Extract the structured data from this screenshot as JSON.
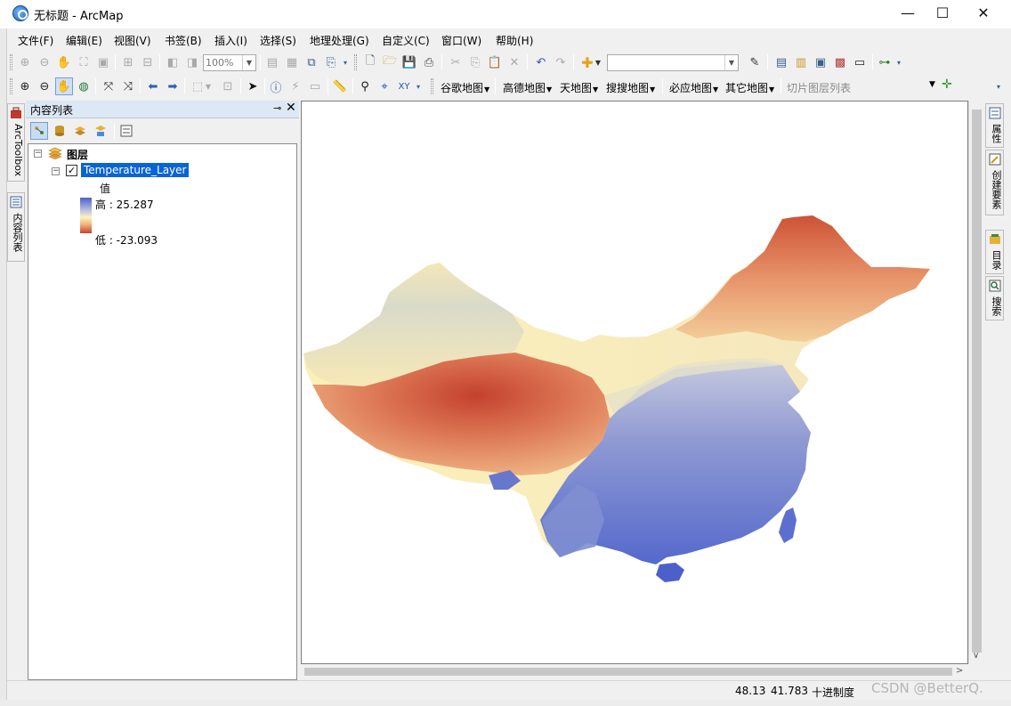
{
  "window": {
    "title": "无标题 - ArcMap",
    "minimize": "—",
    "maximize": "☐",
    "close": "✕"
  },
  "menubar": [
    "文件(F)",
    "编辑(E)",
    "视图(V)",
    "书签(B)",
    "插入(I)",
    "选择(S)",
    "地理处理(G)",
    "自定义(C)",
    "窗口(W)",
    "帮助(H)"
  ],
  "toolbar1": {
    "zoom_value": "100%",
    "scale_combo_value": ""
  },
  "toolbar2": {
    "map_sources": [
      "谷歌地图",
      "高德地图",
      "天地图",
      "搜搜地图",
      "必应地图",
      "其它地图"
    ],
    "tile_list_placeholder": "切片图层列表"
  },
  "left_tabs": {
    "arctoolbox": "ArcToolbox",
    "toc_tab": "内容列表"
  },
  "toc": {
    "title": "内容列表",
    "pin": "ᵖ",
    "close": "✕",
    "root_label": "图层",
    "layer_name": "Temperature_Layer",
    "layer_checked": true,
    "value_label": "值",
    "high_label": "高 : 25.287",
    "low_label": "低 : -23.093",
    "ramp_colors": [
      "#4d60c9",
      "#fbf4bd",
      "#c8402f"
    ]
  },
  "right_tabs": [
    "属性",
    "创建要素",
    "目录",
    "搜索"
  ],
  "statusbar": {
    "x": "48.13",
    "y": "41.783",
    "units": "十进制度"
  },
  "watermark": "CSDN @BetterQ.",
  "map_colors": {
    "cold": "#c8402f",
    "mid": "#fbf4bd",
    "warm": "#4d60c9"
  }
}
